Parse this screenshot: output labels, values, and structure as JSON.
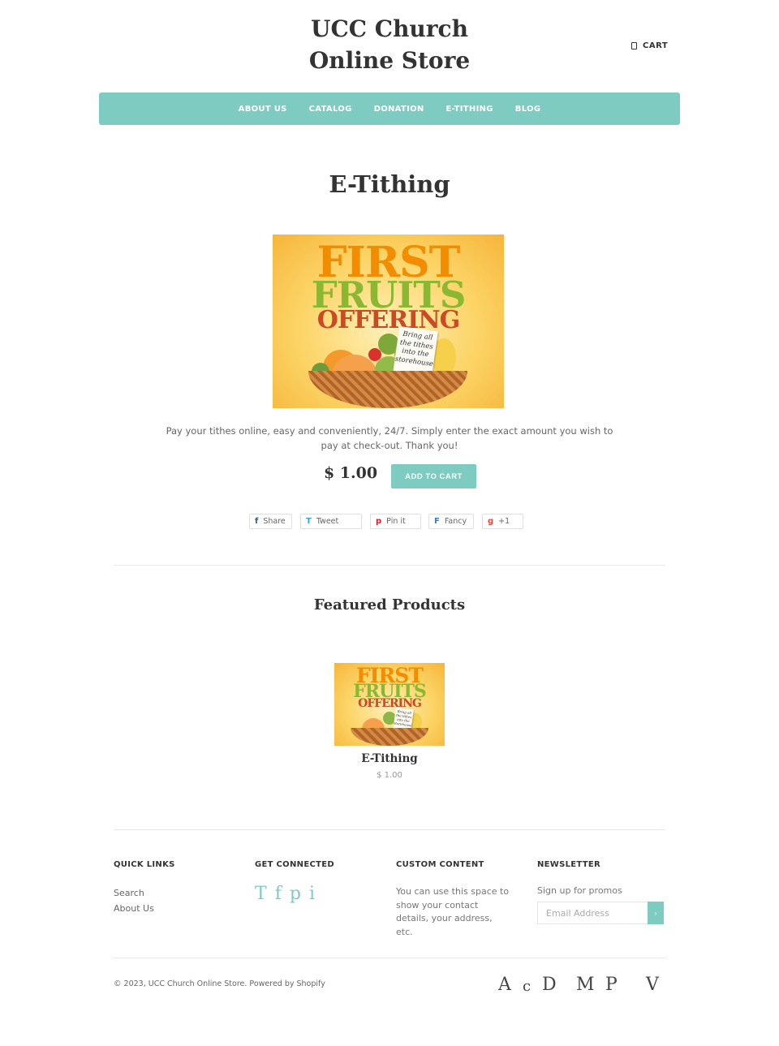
{
  "header": {
    "store_name_line1": "UCC Church",
    "store_name_line2": "Online Store",
    "cart_label": "CART"
  },
  "nav": {
    "items": [
      "ABOUT US",
      "CATALOG",
      "DONATION",
      "E-TITHING",
      "BLOG"
    ]
  },
  "product": {
    "title": "E-Tithing",
    "image": {
      "line1": "FIRST",
      "line2": "FRUITS",
      "line3": "OFFERING",
      "sign_text": [
        "Bring all",
        "the tithes",
        "into the",
        "storehouse"
      ]
    },
    "description": "Pay your tithes online, easy and conveniently, 24/7. Simply enter the exact amount you wish to pay at check-out. Thank you!",
    "price": "$ 1.00",
    "add_to_cart_label": "ADD TO CART"
  },
  "share": {
    "facebook": {
      "glyph": "f",
      "label": "Share"
    },
    "twitter": {
      "glyph": "T",
      "label": "Tweet"
    },
    "pinterest": {
      "glyph": "p",
      "label": "Pin it"
    },
    "fancy": {
      "glyph": "F",
      "label": "Fancy"
    },
    "google": {
      "glyph": "g",
      "label": "+1"
    }
  },
  "featured": {
    "heading": "Featured Products",
    "items": [
      {
        "title": "E-Tithing",
        "price": "$ 1.00"
      }
    ]
  },
  "footer": {
    "quick_links": {
      "heading": "QUICK LINKS",
      "links": [
        "Search",
        "About Us"
      ]
    },
    "get_connected": {
      "heading": "GET CONNECTED",
      "icons": [
        "T",
        "f",
        "p",
        "i"
      ]
    },
    "custom_content": {
      "heading": "CUSTOM CONTENT",
      "text": "You can use this space to show your contact details, your address, etc."
    },
    "newsletter": {
      "heading": "NEWSLETTER",
      "text": "Sign up for promos",
      "placeholder": "Email Address",
      "button_glyph": "›"
    },
    "copyright": "© 2023, UCC Church Online Store. Powered by Shopify",
    "payment_icons": [
      "A",
      "c",
      "D",
      "M",
      "P",
      "V"
    ]
  },
  "colors": {
    "accent": "#7dcbc1",
    "text_dark": "#333333"
  }
}
